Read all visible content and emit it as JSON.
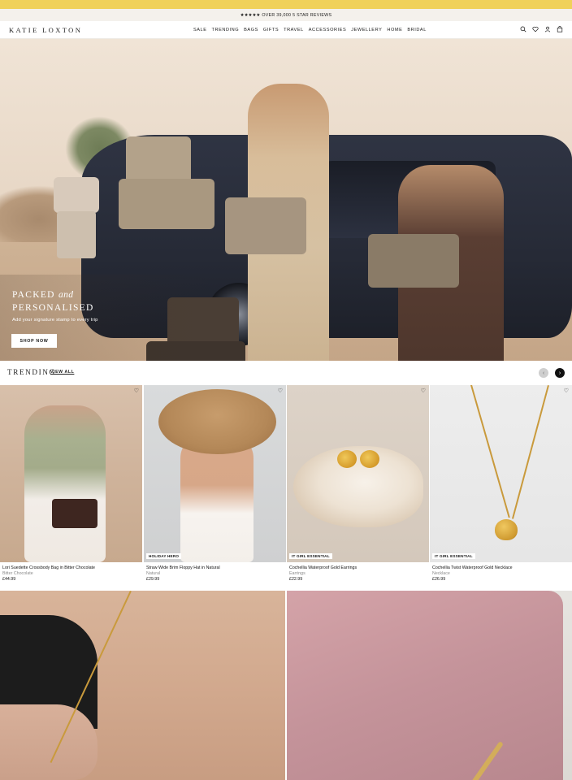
{
  "promo": {
    "text": ""
  },
  "reviews": {
    "stars": "★★★★★",
    "text": "OVER 39,000 5 STAR REVIEWS"
  },
  "header": {
    "logo": "KATIE LOXTON",
    "nav": [
      "SALE",
      "TRENDING",
      "BAGS",
      "GIFTS",
      "TRAVEL",
      "ACCESSORIES",
      "JEWELLERY",
      "HOME",
      "BRIDAL"
    ],
    "icons": [
      "search-icon",
      "heart-icon",
      "user-icon",
      "bag-icon"
    ]
  },
  "hero": {
    "title_line1_a": "PACKED",
    "title_line1_b": "and",
    "title_line2": "PERSONALISED",
    "subtitle": "Add your signature stamp to every trip",
    "button": "SHOP NOW"
  },
  "trending": {
    "title": "TRENDING",
    "view_all": "VIEW ALL",
    "prev_arrow": "‹",
    "next_arrow": "›"
  },
  "products": [
    {
      "name": "Lori Suedette Crossbody Bag in Bitter Chocolate",
      "variant": "Bitter Chocolate",
      "price": "£44.99",
      "badge": ""
    },
    {
      "name": "Straw Wide Brim Floppy Hat in Natural",
      "variant": "Natural",
      "price": "£29.99",
      "badge": "HOLIDAY HERO"
    },
    {
      "name": "Cochellia Waterproof Gold Earrings",
      "variant": "Earrings",
      "price": "£22.99",
      "badge": "IT GIRL ESSENTIAL"
    },
    {
      "name": "Cochellia Twist Waterproof Gold Necklace",
      "variant": "Necklace",
      "price": "£26.99",
      "badge": "IT GIRL ESSENTIAL"
    }
  ],
  "colors": {
    "promo_bar": "#f0d15a",
    "reviews_bar": "#f4f1ec",
    "text": "#1a1a1a"
  }
}
